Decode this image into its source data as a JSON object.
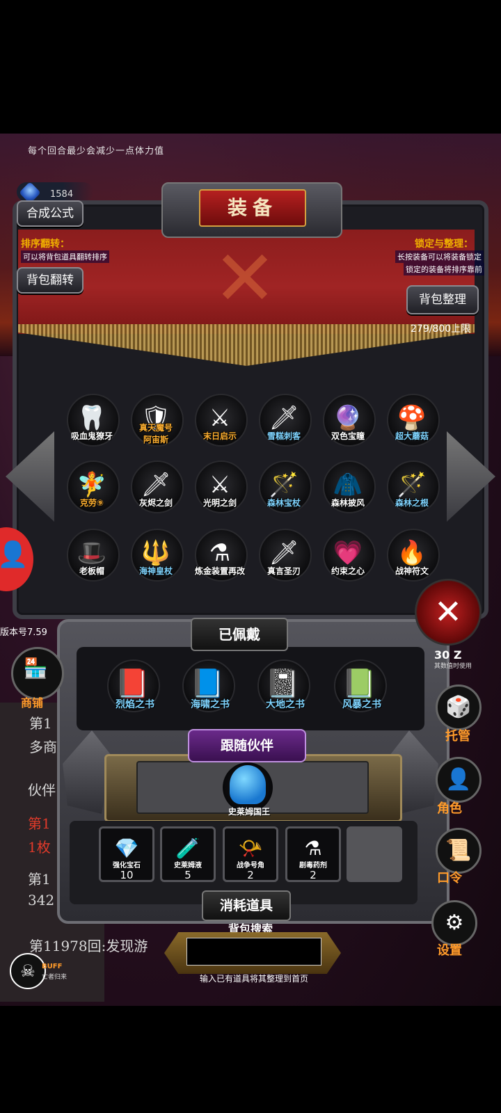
{
  "top": {
    "hint": "每个回合最少会减少一点体力值",
    "crystal_count": "1584"
  },
  "panel": {
    "title": "装备",
    "formula_button": "合成公式",
    "sort_tip_title": "排序翻转：",
    "sort_tip_desc": "可以将背包道具翻转排序",
    "flip_button": "背包翻转",
    "lock_tip_title": "锁定与整理：",
    "lock_tip_desc1": "长按装备可以将装备锁定",
    "lock_tip_desc2": "锁定的装备将排序靠前",
    "sort_button": "背包整理",
    "capacity": "279/800上限"
  },
  "items": [
    {
      "label": "吸血鬼獠牙",
      "glyph": "🦷",
      "color": "white"
    },
    {
      "label": "真天魔号\n阿宙斯",
      "glyph": "🛡",
      "color": "orange"
    },
    {
      "label": "末日启示",
      "glyph": "⚔",
      "color": "orange"
    },
    {
      "label": "雪糕刺客",
      "glyph": "🗡",
      "color": "blue"
    },
    {
      "label": "双色宝瞳",
      "glyph": "🔮",
      "color": "white"
    },
    {
      "label": "超大蘑菇",
      "glyph": "🍄",
      "color": "blue"
    },
    {
      "label": "克劳⑨",
      "glyph": "🧚",
      "color": "orange"
    },
    {
      "label": "灰烬之剑",
      "glyph": "🗡",
      "color": "white"
    },
    {
      "label": "光明之剑",
      "glyph": "⚔",
      "color": "white"
    },
    {
      "label": "森林宝杖",
      "glyph": "🪄",
      "color": "blue"
    },
    {
      "label": "森林披风",
      "glyph": "🧥",
      "color": "white"
    },
    {
      "label": "森林之根",
      "glyph": "🪄",
      "color": "blue"
    },
    {
      "label": "老板帽",
      "glyph": "🎩",
      "color": "white"
    },
    {
      "label": "海神皇杖",
      "glyph": "🔱",
      "color": "blue"
    },
    {
      "label": "炼金装置再改",
      "glyph": "⚗",
      "color": "white"
    },
    {
      "label": "真言圣刃",
      "glyph": "🗡",
      "color": "white"
    },
    {
      "label": "约束之心",
      "glyph": "💗",
      "color": "white"
    },
    {
      "label": "战神符文",
      "glyph": "🔥",
      "color": "white"
    }
  ],
  "equipped": {
    "title": "已佩戴",
    "books": [
      {
        "label": "烈焰之书",
        "glyph": "📕"
      },
      {
        "label": "海啸之书",
        "glyph": "📘"
      },
      {
        "label": "大地之书",
        "glyph": "📓"
      },
      {
        "label": "风暴之书",
        "glyph": "📗"
      }
    ],
    "companion_title": "跟随伙伴",
    "companion_name": "史莱姆国王",
    "consumables_title": "消耗道具",
    "consumables": [
      {
        "label": "强化宝石",
        "count": "10",
        "glyph": "💎"
      },
      {
        "label": "史莱姆液",
        "count": "5",
        "glyph": "🧪"
      },
      {
        "label": "战争号角",
        "count": "2",
        "glyph": "📯"
      },
      {
        "label": "剧毒药剂",
        "count": "2",
        "glyph": "⚗"
      }
    ]
  },
  "search": {
    "label": "背包搜索",
    "value": "",
    "hint": "输入已有道具将其整理到首页"
  },
  "side": {
    "version": "版本号7.59",
    "shop": "商铺",
    "log_lines": [
      "第1",
      "多商",
      "伙伴岁",
      "第1",
      "1枚",
      "第1",
      "342",
      "第11978回:发现游"
    ],
    "right_count": "30 Z",
    "right_count_desc": "其数值时使用",
    "manage": "托管",
    "role": "角色",
    "command": "口令",
    "settings": "设置",
    "buff": "BUFF",
    "buff_sub": "亡者归来"
  }
}
